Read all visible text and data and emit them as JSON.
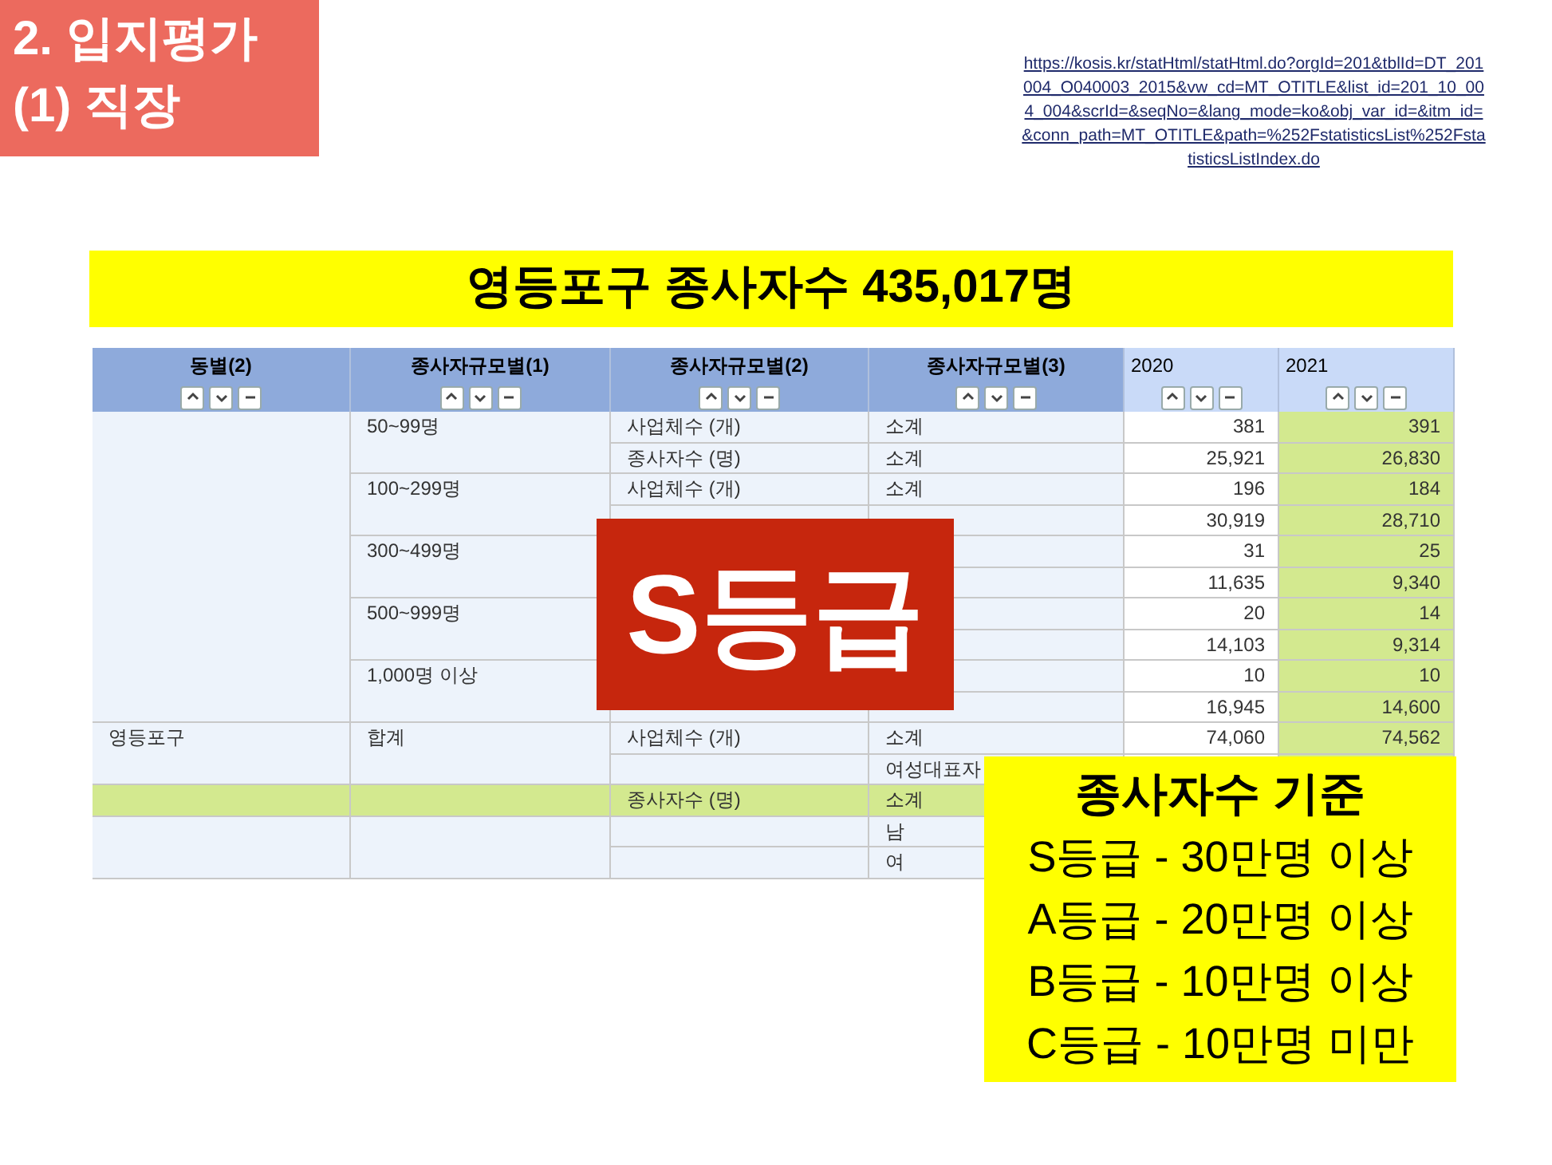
{
  "slide_title": [
    "2. 입지평가",
    "(1) 직장"
  ],
  "source_link": "https://kosis.kr/statHtml/statHtml.do?orgId=201&tblId=DT_201004_O040003_2015&vw_cd=MT_OTITLE&list_id=201_10_004_004&scrId=&seqNo=&lang_mode=ko&obj_var_id=&itm_id=&conn_path=MT_OTITLE&path=%252FstatisticsList%252FstatisticsListIndex.do",
  "banner": "영등포구 종사자수 435,017명",
  "table": {
    "columns": [
      {
        "label": "동별(2)",
        "kind": "dimension",
        "highlighted": false
      },
      {
        "label": "종사자규모별(1)",
        "kind": "dimension",
        "highlighted": false
      },
      {
        "label": "종사자규모별(2)",
        "kind": "dimension",
        "highlighted": false
      },
      {
        "label": "종사자규모별(3)",
        "kind": "dimension",
        "highlighted": false
      },
      {
        "label": "2020",
        "kind": "period",
        "highlighted": false
      },
      {
        "label": "2021",
        "kind": "period",
        "highlighted": true
      }
    ],
    "rows": [
      {
        "highlighted": false,
        "cells": [
          null,
          "50~99명",
          "사업체수 (개)",
          "소계",
          "381",
          "391"
        ]
      },
      {
        "highlighted": false,
        "cells": [
          null,
          null,
          "종사자수 (명)",
          "소계",
          "25,921",
          "26,830"
        ]
      },
      {
        "highlighted": false,
        "cells": [
          null,
          "100~299명",
          "사업체수 (개)",
          "소계",
          "196",
          "184"
        ]
      },
      {
        "highlighted": false,
        "cells": [
          null,
          null,
          null,
          null,
          "30,919",
          "28,710"
        ]
      },
      {
        "highlighted": false,
        "cells": [
          null,
          "300~499명",
          null,
          null,
          "31",
          "25"
        ]
      },
      {
        "highlighted": false,
        "cells": [
          null,
          null,
          null,
          null,
          "11,635",
          "9,340"
        ]
      },
      {
        "highlighted": false,
        "cells": [
          null,
          "500~999명",
          null,
          null,
          "20",
          "14"
        ]
      },
      {
        "highlighted": false,
        "cells": [
          null,
          null,
          null,
          null,
          "14,103",
          "9,314"
        ]
      },
      {
        "highlighted": false,
        "cells": [
          null,
          "1,000명 이상",
          null,
          null,
          "10",
          "10"
        ]
      },
      {
        "highlighted": false,
        "cells": [
          null,
          null,
          null,
          null,
          "16,945",
          "14,600"
        ]
      },
      {
        "highlighted": false,
        "cells": [
          "영등포구",
          "합계",
          "사업체수 (개)",
          "소계",
          "74,060",
          "74,562"
        ]
      },
      {
        "highlighted": false,
        "cells": [
          null,
          null,
          null,
          "여성대표자",
          null,
          null
        ]
      },
      {
        "highlighted": true,
        "cells": [
          null,
          null,
          "종사자수 (명)",
          "소계",
          null,
          null
        ]
      },
      {
        "highlighted": false,
        "cells": [
          null,
          null,
          null,
          "남",
          null,
          null
        ]
      },
      {
        "highlighted": false,
        "cells": [
          null,
          null,
          null,
          "여",
          null,
          null
        ]
      }
    ]
  },
  "grade_stamp": "S등급",
  "criteria": {
    "title": "종사자수 기준",
    "lines": [
      "S등급 - 30만명 이상",
      "A등급 - 20만명 이상",
      "B등급 - 10만명 이상",
      "C등급 - 10만명 미만"
    ]
  }
}
